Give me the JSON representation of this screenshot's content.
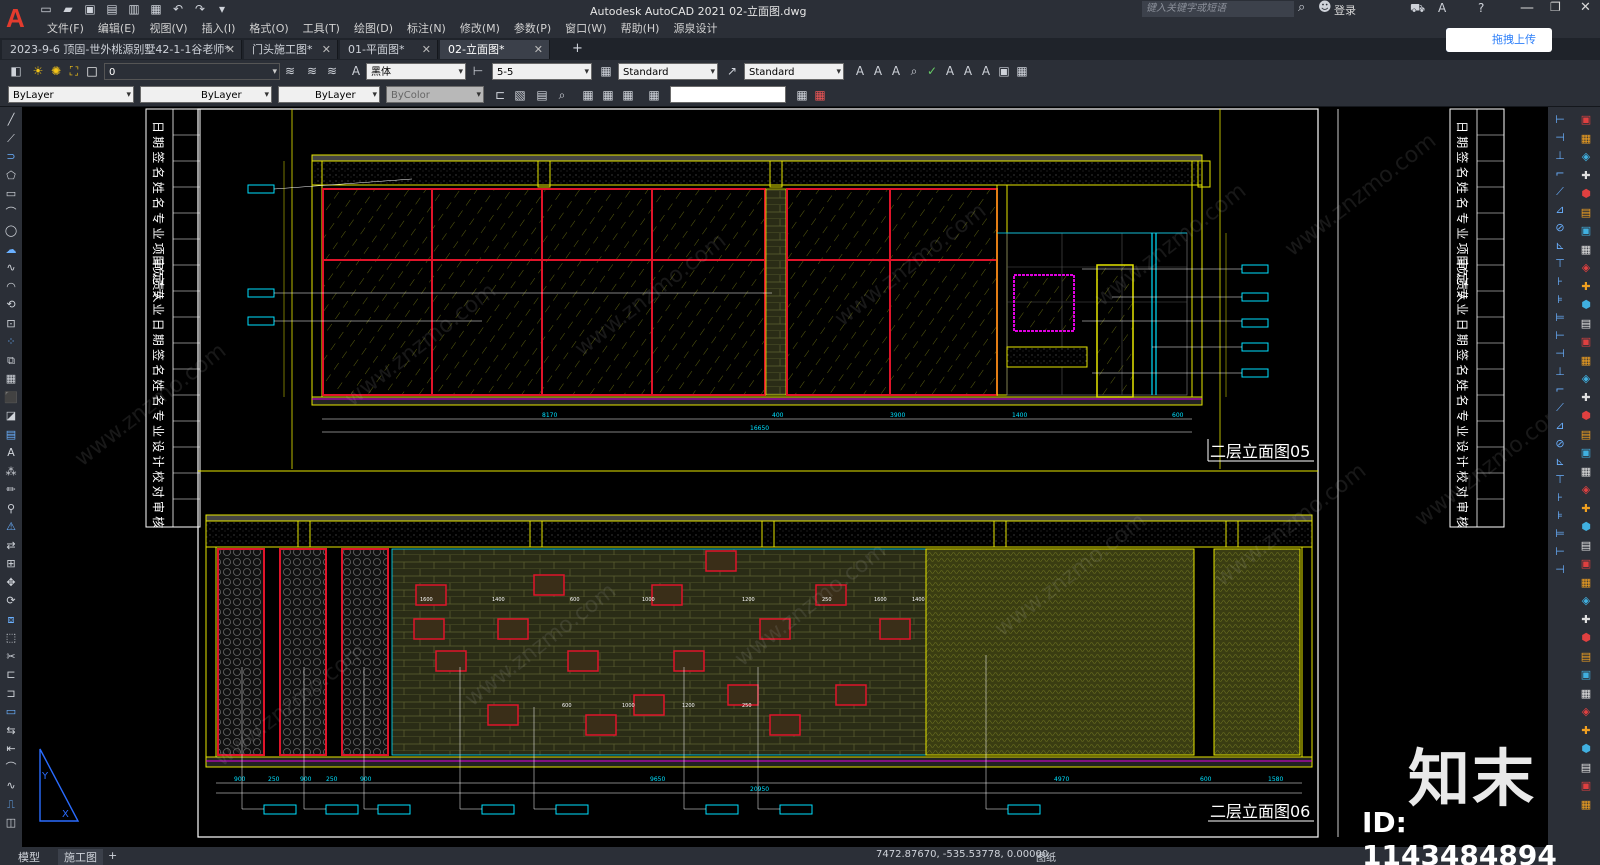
{
  "app": {
    "window_title": "Autodesk AutoCAD 2021    02-立面图.dwg",
    "menu": [
      "文件(F)",
      "编辑(E)",
      "视图(V)",
      "插入(I)",
      "格式(O)",
      "工具(T)",
      "绘图(D)",
      "标注(N)",
      "修改(M)",
      "参数(P)",
      "窗口(W)",
      "帮助(H)",
      "源泉设计"
    ],
    "search_placeholder": "键入关键字或短语",
    "login_label": "登录",
    "upload_label": "拖拽上传"
  },
  "tabs": [
    {
      "label": "2023-9-6 顶固-世外桃源别墅42-1-1谷老师*",
      "active": false
    },
    {
      "label": "门头施工图*",
      "active": false
    },
    {
      "label": "01-平面图*",
      "active": false
    },
    {
      "label": "02-立面图*",
      "active": true
    }
  ],
  "toolbar1": {
    "layer_value": "0",
    "font_value": "黑体",
    "dimstyle_value": "5-5",
    "textstyle_value": "Standard",
    "tablestyle_value": "Standard"
  },
  "toolbar2": {
    "color_value": "ByLayer",
    "linetype_value": "ByLayer",
    "lineweight_value": "ByLayer",
    "plotstyle_value": "ByColor"
  },
  "drawing": {
    "title_05": "二层立面图05",
    "title_06": "二层立面图06",
    "watermark_site": "www.znzmo.com",
    "dims_05": [
      "8170",
      "400",
      "3900",
      "1400",
      "600"
    ],
    "dims_05_total": "16650",
    "dims_06": [
      "900",
      "250",
      "900",
      "250",
      "900",
      "9650",
      "4970",
      "600",
      "1580"
    ],
    "dims_06_total": "20950",
    "brick_dims": [
      "1600",
      "1400",
      "600",
      "1000",
      "1200",
      "250"
    ],
    "titleblock_chars": [
      "日",
      "期",
      "签",
      "名",
      "姓",
      "名",
      "专",
      "业",
      "项目负责人",
      "审",
      "定",
      "专",
      "业",
      "日",
      "期",
      "签",
      "名",
      "姓",
      "名",
      "专",
      "业",
      "设",
      "计",
      "校",
      "对",
      "审",
      "核"
    ]
  },
  "status": {
    "layout_tabs": [
      "模型",
      "施工图"
    ],
    "active_layout": "施工图",
    "coords": "7472.87670, -535.53778, 0.00000",
    "model_label": "图纸"
  },
  "watermark": {
    "logo": "知末",
    "id_label": "ID: 1143484894"
  },
  "colors": {
    "accent_blue": "#2d7ff9",
    "cad_red": "#e0142a",
    "cad_yellow": "#e6e600",
    "cad_cyan": "#00e0ff",
    "cad_magenta": "#e000e0"
  }
}
